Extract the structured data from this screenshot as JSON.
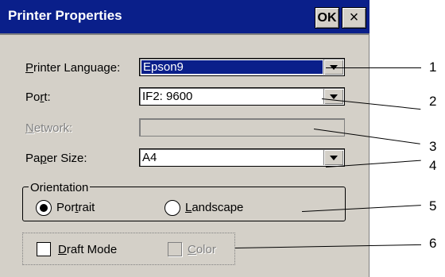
{
  "window": {
    "title": "Printer Properties",
    "ok_label": "OK",
    "close_label": "×"
  },
  "fields": {
    "printer_language": {
      "label_pre": "",
      "label_ul": "P",
      "label_post": "rinter Language:",
      "value": "Epson9"
    },
    "port": {
      "label_pre": "Po",
      "label_ul": "r",
      "label_post": "t:",
      "value": "IF2: 9600"
    },
    "network": {
      "label_pre": "",
      "label_ul": "N",
      "label_post": "etwork:",
      "value": ""
    },
    "paper_size": {
      "label_pre": "Pa",
      "label_ul": "p",
      "label_post": "er Size:",
      "value": "A4"
    }
  },
  "orientation": {
    "group_label": "Orientation",
    "portrait": {
      "pre": "Por",
      "ul": "t",
      "post": "rait",
      "selected": true
    },
    "landscape": {
      "pre": "",
      "ul": "L",
      "post": "andscape",
      "selected": false
    }
  },
  "options": {
    "draft": {
      "pre": "",
      "ul": "D",
      "post": "raft Mode",
      "checked": false
    },
    "color": {
      "pre": "",
      "ul": "C",
      "post": "olor",
      "checked": false,
      "disabled": true
    }
  },
  "callouts": [
    "1",
    "2",
    "3",
    "4",
    "5",
    "6"
  ],
  "colors": {
    "titlebar": "#0a1f8a",
    "dialog": "#d4d0c8",
    "selection": "#0a1f8a"
  }
}
